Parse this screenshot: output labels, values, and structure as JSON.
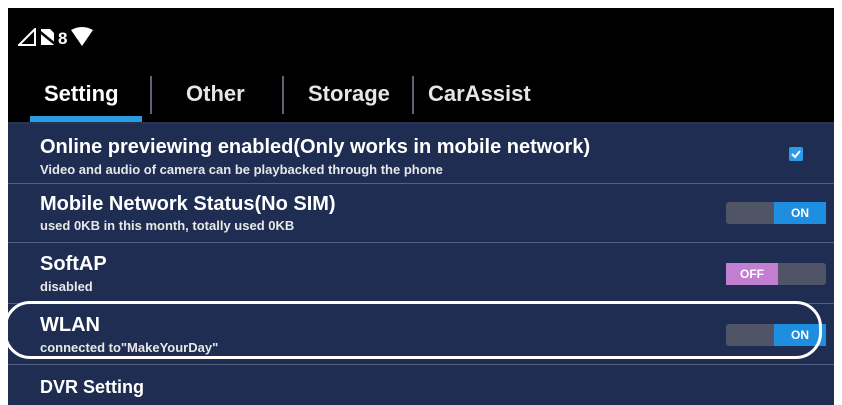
{
  "status_bar": {
    "icons": [
      "signal-icon",
      "no-sim-icon",
      "wifi-icon"
    ],
    "badge": "8"
  },
  "tabs": [
    {
      "label": "Setting",
      "active": true
    },
    {
      "label": "Other",
      "active": false
    },
    {
      "label": "Storage",
      "active": false
    },
    {
      "label": "CarAssist",
      "active": false
    }
  ],
  "settings": {
    "online_preview": {
      "title": "Online previewing enabled(Only works in mobile network)",
      "subtitle": "Video and audio of camera can be playbacked through the phone",
      "checked": true
    },
    "mobile_network": {
      "title": "Mobile Network Status(No SIM)",
      "subtitle": "used 0KB in this month, totally used 0KB",
      "toggle": "ON"
    },
    "softap": {
      "title": "SoftAP",
      "subtitle": "disabled",
      "toggle": "OFF"
    },
    "wlan": {
      "title": "WLAN",
      "subtitle": "connected to\"MakeYourDay\"",
      "toggle": "ON"
    },
    "dvr": {
      "title": "DVR Setting"
    }
  },
  "colors": {
    "accent": "#2a9be0",
    "background": "#1f2d52",
    "toggle_on": "#1e8fe0",
    "toggle_off": "#c27fd1"
  }
}
